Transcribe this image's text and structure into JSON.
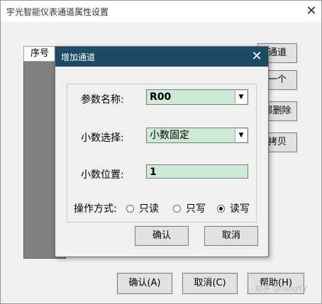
{
  "window": {
    "title": "宇光智能仪表通道属性设置",
    "close_glyph": "✕",
    "list_header": "序号",
    "side_buttons": [
      "通道",
      "一个",
      "部删除",
      "拷贝"
    ],
    "bottom_buttons": [
      "确认(A)",
      "取消(C)",
      "帮助(H)"
    ],
    "watermark": "知乎 @fangYY"
  },
  "dialog": {
    "title": "增加通道",
    "close_glyph": "✕",
    "fields": {
      "param_name": {
        "label": "参数名称:",
        "value": "R00"
      },
      "decimal_select": {
        "label": "小数选择:",
        "value": "小数固定"
      },
      "decimal_position": {
        "label": "小数位置:",
        "value": "1"
      }
    },
    "mode": {
      "label": "操作方式:",
      "options": [
        "只读",
        "只写",
        "读写"
      ],
      "selected": "读写"
    },
    "ok_label": "确认",
    "cancel_label": "取消"
  },
  "icons": {
    "dropdown": "dropdown-arrow-icon",
    "close": "close-icon"
  }
}
